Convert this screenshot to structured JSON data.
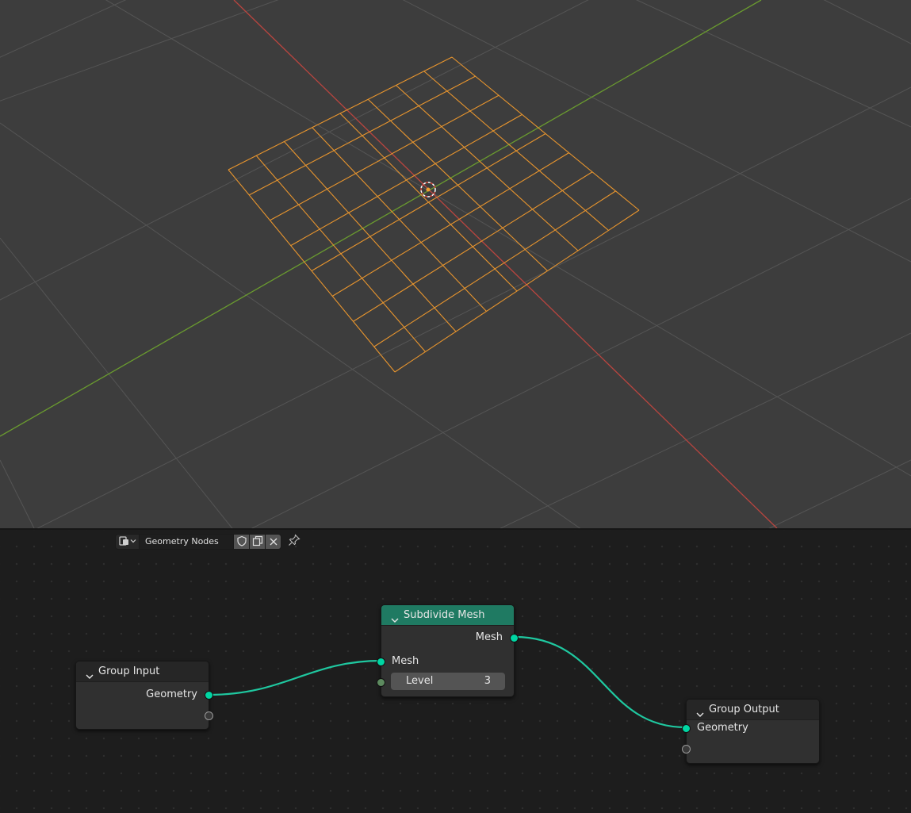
{
  "viewport": {
    "colors": {
      "background": "#3d3d3d",
      "grid": "#545454",
      "x_axis": "#b9453f",
      "y_axis": "#6a9b2f",
      "selection": "#f0a030"
    }
  },
  "node_editor": {
    "header": {
      "editor_type_icon": "node-editor-icon",
      "tree_name": "Geometry Nodes",
      "buttons": [
        "fake-user-shield-icon",
        "duplicate-icon",
        "close-icon"
      ],
      "pin_icon": "pin-icon"
    },
    "nodes": {
      "group_input": {
        "title": "Group Input",
        "outputs": [
          "Geometry"
        ]
      },
      "subdivide_mesh": {
        "title": "Subdivide Mesh",
        "outputs": [
          "Mesh"
        ],
        "inputs": [
          "Mesh"
        ],
        "level_label": "Level",
        "level_value": "3"
      },
      "group_output": {
        "title": "Group Output",
        "inputs": [
          "Geometry"
        ]
      }
    },
    "colors": {
      "link": "#1fc8a0",
      "header_geometry": "#1f7a62"
    }
  }
}
